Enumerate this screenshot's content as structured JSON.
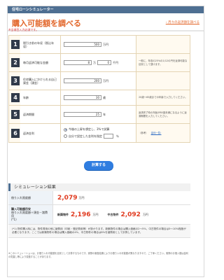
{
  "header": {
    "app_title": "住宅ローンシミュレーター",
    "page_title": "購入可能額を調べる",
    "top_link": "月々の返済額を調べる"
  },
  "required_note": "※全項目入力必須です。",
  "form": {
    "rows": [
      {
        "num": "1",
        "label": "税引き前の年収（税込年収）",
        "value": "500",
        "unit": "万円",
        "note": ""
      },
      {
        "num": "2",
        "label": "毎月返済可能な金額",
        "value1": "8",
        "unit1": "万",
        "value2": "0",
        "unit2": "千円",
        "note": "一般に、年収の25%の1/12の円を返済可能な目安として頂けます。"
      },
      {
        "num": "3",
        "label": "住宅購入にかけられる自己資金（頭金）",
        "value": "200",
        "unit": "万円",
        "note": ""
      },
      {
        "num": "4",
        "label": "年齢",
        "value": "30",
        "unit": "歳",
        "note": "20歳〜65歳までの年齢で入力してください。"
      },
      {
        "num": "5",
        "label": "返済期間",
        "value": "25",
        "unit": "年",
        "note": "返済完了時の年齢が80歳未満になるように返済期間を入力してください。"
      },
      {
        "num": "6",
        "label": "返済金利",
        "radio1": "今後の上昇を想定し、3%で試算",
        "radio2": "自分で設定した金利を指定",
        "unit": "％",
        "note_prefix": "（参考）",
        "note_link": "金利一覧"
      }
    ]
  },
  "calc_button": "計算する",
  "result": {
    "heading": "シミュレーション結果",
    "loan_label": "借り入れ限度額",
    "loan_value": "2,079",
    "loan_unit": "万円",
    "purchase_label": "購入可能額目安",
    "purchase_sub": "借り入れ限度額＋頭金－諸費用",
    "purchase_note": "(*1)",
    "new_label": "新築物件",
    "new_value": "2,196",
    "used_label": "中古物件",
    "used_value": "2,092",
    "unit": "万円",
    "explain": "(*1) 物件購入時には、物件費用の他に諸費用（印紙・登記費用等）が掛かります。新築物件の場合は購入価格の2〜5%、中古物件の場合は5〜10%程度が必要となります。ここでは新築物件の場合は購入価格の4%、中古物件の場合は8%を諸費用として計算しています。"
  },
  "footnote": "※このシミュレーションは、お借り入れ可能額を目安として計算するものです。実際の審査結果によりお借り入れ可能額が異なりますので、ご了承ください。実際のお借入額は金利の見直し等により変動することがあります。"
}
